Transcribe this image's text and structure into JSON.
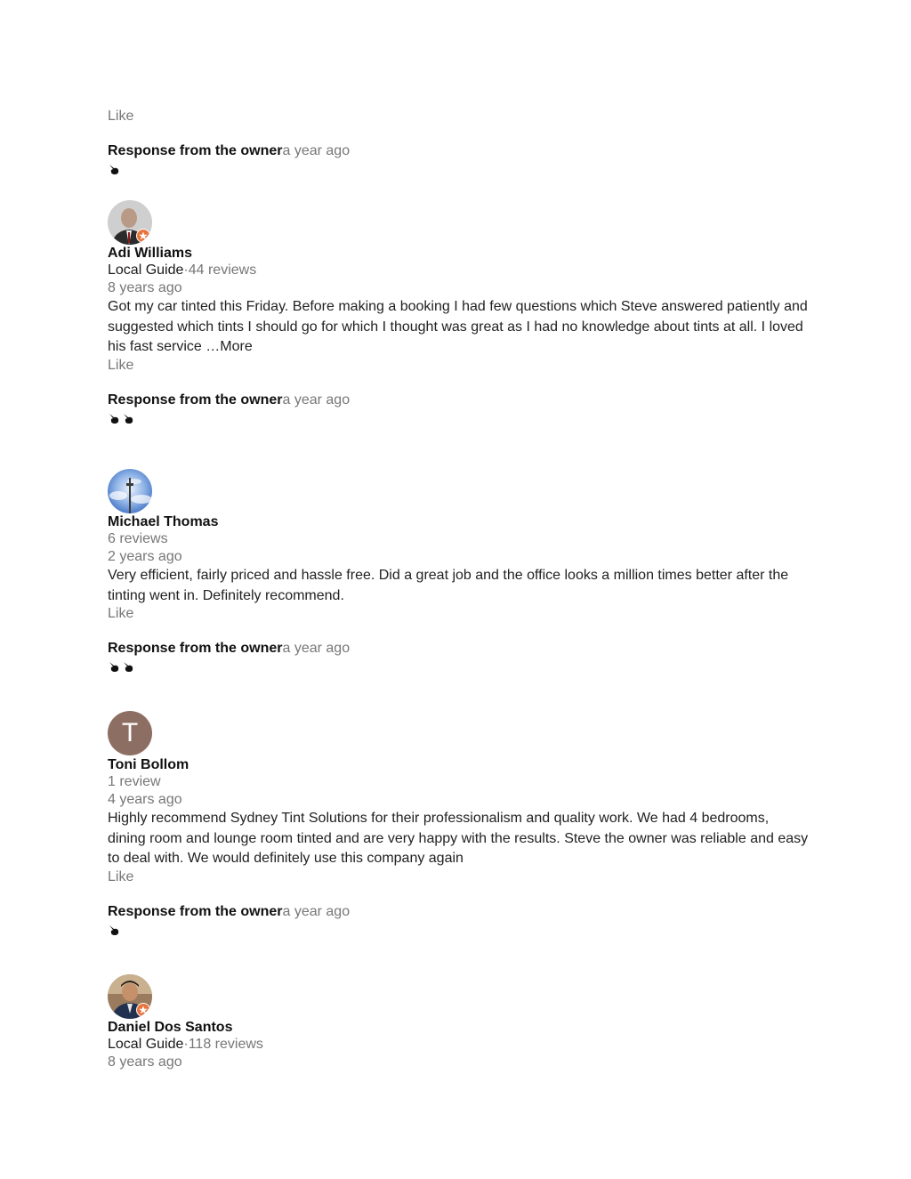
{
  "labels": {
    "like": "Like",
    "response_title": "Response from the owner",
    "response_time": "a year ago",
    "more": "More",
    "guide_sep": "·"
  },
  "reviews": [
    {
      "name": "Adi Williams",
      "guide": "Local Guide",
      "reviews_count": "44 reviews",
      "time": "8 years ago",
      "text": "Got my car tinted this Friday. Before making a booking I had few questions which Steve answered patiently and suggested which tints I should go for which I thought was great as I had no knowledge about tints at all. I loved his fast service …",
      "response_emoji_count": 2
    },
    {
      "name": "Michael Thomas",
      "reviews_count": "6 reviews",
      "time": "2 years ago",
      "text": "Very efficient, fairly priced and hassle free. Did a great job and the office looks a million times better after the tinting went in. Definitely recommend.",
      "response_emoji_count": 2
    },
    {
      "name": "Toni Bollom",
      "avatar_letter": "T",
      "reviews_count": "1 review",
      "time": "4 years ago",
      "text": "Highly recommend Sydney Tint Solutions for their professionalism and quality work. We had 4 bedrooms, dining room and lounge room tinted and are very happy with the results. Steve the owner was reliable and easy to deal with. We would definitely use this company again",
      "response_emoji_count": 1
    },
    {
      "name": "Daniel Dos Santos",
      "guide": "Local Guide",
      "reviews_count": "118 reviews",
      "time": "8 years ago"
    }
  ],
  "colors": {
    "muted_text": "#777777",
    "badge": "#e8743b",
    "letter_avatar_bg": "#8d6e63"
  }
}
